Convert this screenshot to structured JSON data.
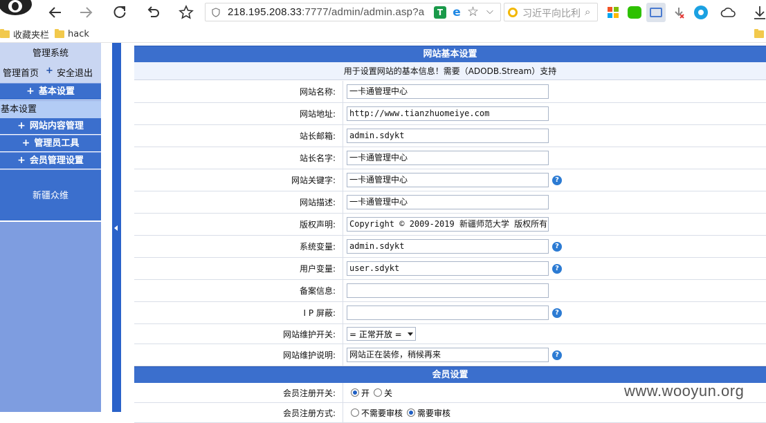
{
  "browser": {
    "url_host": "218.195.208.33",
    "url_port": ":7777",
    "url_path": "/admin/admin.asp?a",
    "search_placeholder": "习近平向比利",
    "bookmarks": [
      {
        "label": "收藏夹栏"
      },
      {
        "label": "hack"
      }
    ]
  },
  "nav": {
    "title": "管理系统",
    "home_link": "管理首页",
    "logout_link": "安全退出",
    "menus": [
      {
        "label": "基本设置"
      },
      {
        "label": "网站内容管理"
      },
      {
        "label": "管理员工具"
      },
      {
        "label": "会员管理设置"
      }
    ],
    "active_sub": "基本设置",
    "footer": "新疆众维"
  },
  "main": {
    "header": "网站基本设置",
    "note": "用于设置网站的基本信息！需要（ADODB.Stream）支持",
    "fields": [
      {
        "label": "网站名称:",
        "value": "一卡通管理中心",
        "help": false
      },
      {
        "label": "网站地址:",
        "value": "http://www.tianzhuomeiye.com",
        "help": false
      },
      {
        "label": "站长邮箱:",
        "value": "admin.sdykt",
        "help": false
      },
      {
        "label": "站长名字:",
        "value": "一卡通管理中心",
        "help": false
      },
      {
        "label": "网站关键字:",
        "value": "一卡通管理中心",
        "help": true
      },
      {
        "label": "网站描述:",
        "value": "一卡通管理中心",
        "help": false
      },
      {
        "label": "版权声明:",
        "value": "Copyright © 2009-2019 新疆师范大学 版权所有",
        "help": false
      },
      {
        "label": "系统变量:",
        "value": "admin.sdykt",
        "help": true
      },
      {
        "label": "用户变量:",
        "value": "user.sdykt",
        "help": true
      },
      {
        "label": "备案信息:",
        "value": "",
        "help": false
      },
      {
        "label": "I P 屏蔽:",
        "value": "",
        "help": true
      }
    ],
    "maintenance_switch": {
      "label": "网站维护开关:",
      "value": "= 正常开放 ="
    },
    "maintenance_note": {
      "label": "网站维护说明:",
      "value": "网站正在装修，稍候再来"
    },
    "member_header": "会员设置",
    "member_register": {
      "label": "会员注册开关:",
      "options": [
        "开",
        "关"
      ],
      "selected": 0
    },
    "member_register_mode": {
      "label": "会员注册方式:",
      "options": [
        "不需要审核",
        "需要审核"
      ],
      "selected": 1
    }
  },
  "watermark": "www.wooyun.org",
  "colors": {
    "nav_blue": "#3b6fcd",
    "nav_light": "#b3ccf5",
    "nav_bg": "#7e9de0",
    "help_blue": "#2c7bd3"
  }
}
